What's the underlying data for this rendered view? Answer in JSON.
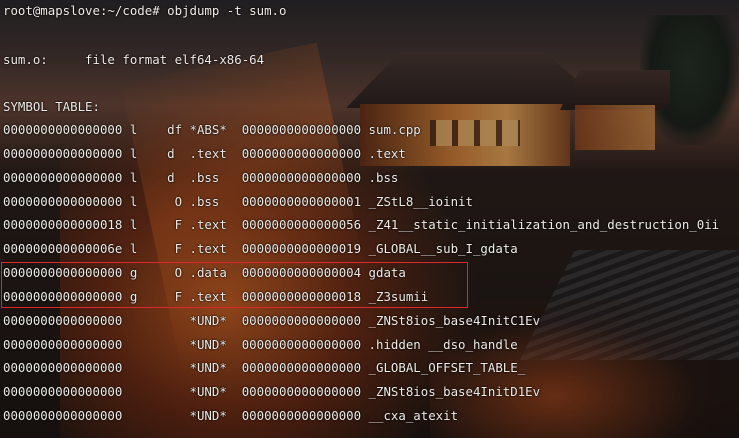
{
  "terminal": {
    "prompt": "root@mapslove:~/code# ",
    "command": "objdump -t sum.o",
    "file_line": "sum.o:     file format elf64-x86-64",
    "symbol_table_header": "SYMBOL TABLE:",
    "symbols": [
      "0000000000000000 l    df *ABS*  0000000000000000 sum.cpp",
      "0000000000000000 l    d  .text  0000000000000000 .text",
      "0000000000000000 l    d  .bss   0000000000000000 .bss",
      "0000000000000000 l     O .bss   0000000000000001 _ZStL8__ioinit",
      "0000000000000018 l     F .text  0000000000000056 _Z41__static_initialization_and_destruction_0ii",
      "000000000000006e l     F .text  0000000000000019 _GLOBAL__sub_I_gdata",
      "0000000000000000 g     O .data  0000000000000004 gdata",
      "0000000000000000 g     F .text  0000000000000018 _Z3sumii",
      "0000000000000000         *UND*  0000000000000000 _ZNSt8ios_base4InitC1Ev",
      "0000000000000000         *UND*  0000000000000000 .hidden __dso_handle",
      "0000000000000000         *UND*  0000000000000000 _GLOBAL_OFFSET_TABLE_",
      "0000000000000000         *UND*  0000000000000000 _ZNSt8ios_base4InitD1Ev",
      "0000000000000000         *UND*  0000000000000000 __cxa_atexit"
    ]
  },
  "colors": {
    "text": "#f0ece8",
    "highlight_border": "#e0262a"
  }
}
